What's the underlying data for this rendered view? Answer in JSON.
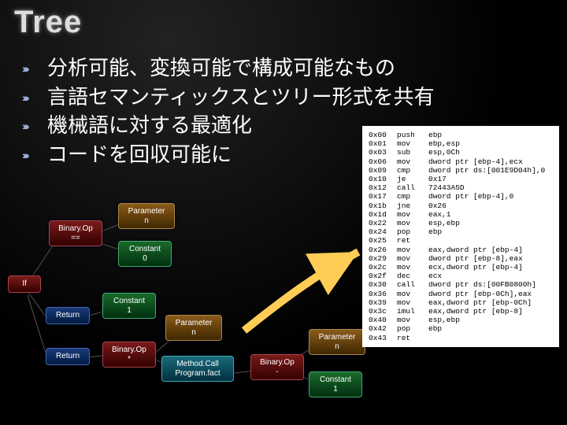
{
  "title": "Tree",
  "chevron_glyph": "»»",
  "bullets": [
    "分析可能、変換可能で構成可能なもの",
    "言語セマンティックスとツリー形式を共有",
    "機械語に対する最適化",
    "コードを回収可能に"
  ],
  "nodes": {
    "if": {
      "label": "If"
    },
    "binop_eq": {
      "label": "Binary.Op\n=="
    },
    "param_n1": {
      "label": "Parameter\nn"
    },
    "const0": {
      "label": "Constant\n0"
    },
    "return1": {
      "label": "Return"
    },
    "const1a": {
      "label": "Constant\n1"
    },
    "return2": {
      "label": "Return"
    },
    "binop_mul": {
      "label": "Binary.Op\n*"
    },
    "param_n2": {
      "label": "Parameter\nn"
    },
    "call": {
      "label": "Method.Call\nProgram.fact"
    },
    "binop_sub": {
      "label": "Binary.Op\n-"
    },
    "param_n3": {
      "label": "Parameter\nn"
    },
    "const1b": {
      "label": "Constant\n1"
    }
  },
  "asm": [
    {
      "addr": "0x00",
      "op": "push",
      "args": "ebp"
    },
    {
      "addr": "0x01",
      "op": "mov",
      "args": "ebp,esp"
    },
    {
      "addr": "0x03",
      "op": "sub",
      "args": "esp,0Ch"
    },
    {
      "addr": "0x06",
      "op": "mov",
      "args": "dword ptr [ebp-4],ecx"
    },
    {
      "addr": "0x09",
      "op": "cmp",
      "args": "dword ptr ds:[001E9D04h],0"
    },
    {
      "addr": "0x10",
      "op": "je",
      "args": "0x17"
    },
    {
      "addr": "0x12",
      "op": "call",
      "args": "72443A5D"
    },
    {
      "addr": "0x17",
      "op": "cmp",
      "args": "dword ptr [ebp-4],0"
    },
    {
      "addr": "0x1b",
      "op": "jne",
      "args": "0x26"
    },
    {
      "addr": "0x1d",
      "op": "mov",
      "args": "eax,1"
    },
    {
      "addr": "0x22",
      "op": "mov",
      "args": "esp,ebp"
    },
    {
      "addr": "0x24",
      "op": "pop",
      "args": "ebp"
    },
    {
      "addr": "0x25",
      "op": "ret",
      "args": ""
    },
    {
      "addr": "0x26",
      "op": "mov",
      "args": "eax,dword ptr [ebp-4]"
    },
    {
      "addr": "0x29",
      "op": "mov",
      "args": "dword ptr [ebp-8],eax"
    },
    {
      "addr": "0x2c",
      "op": "mov",
      "args": "ecx,dword ptr [ebp-4]"
    },
    {
      "addr": "0x2f",
      "op": "dec",
      "args": "ecx"
    },
    {
      "addr": "0x30",
      "op": "call",
      "args": "dword ptr ds:[00FB0800h]"
    },
    {
      "addr": "0x36",
      "op": "mov",
      "args": "dword ptr [ebp-0Ch],eax"
    },
    {
      "addr": "0x39",
      "op": "mov",
      "args": "eax,dword ptr [ebp-0Ch]"
    },
    {
      "addr": "0x3c",
      "op": "imul",
      "args": "eax,dword ptr [ebp-8]"
    },
    {
      "addr": "0x40",
      "op": "mov",
      "args": "esp,ebp"
    },
    {
      "addr": "0x42",
      "op": "pop",
      "args": "ebp"
    },
    {
      "addr": "0x43",
      "op": "ret",
      "args": ""
    }
  ]
}
